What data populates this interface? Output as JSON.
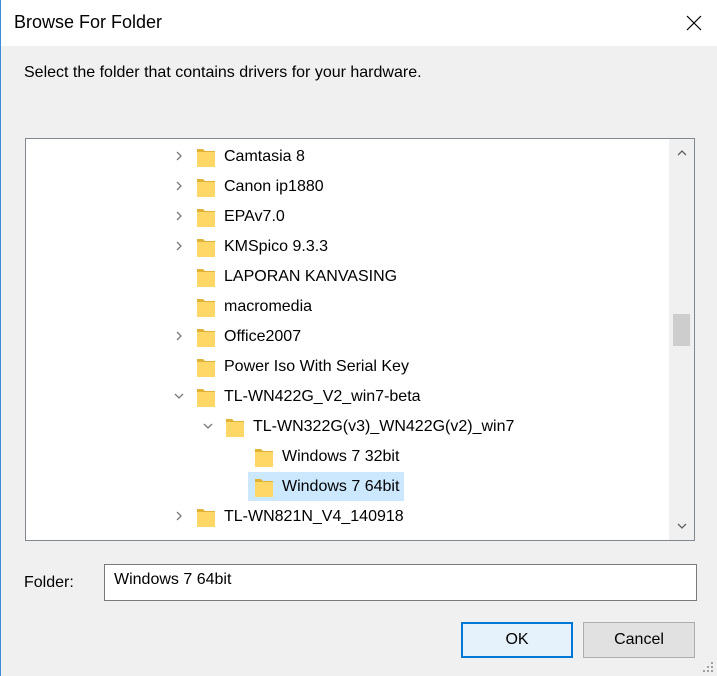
{
  "window": {
    "title": "Browse For Folder"
  },
  "instruction": "Select the folder that contains drivers for your hardware.",
  "tree": {
    "rows": [
      {
        "label": "Camtasia 8",
        "level": 1,
        "expander": "collapsed"
      },
      {
        "label": "Canon ip1880",
        "level": 1,
        "expander": "collapsed"
      },
      {
        "label": "EPAv7.0",
        "level": 1,
        "expander": "collapsed"
      },
      {
        "label": "KMSpico 9.3.3",
        "level": 1,
        "expander": "collapsed"
      },
      {
        "label": "LAPORAN KANVASING",
        "level": 1,
        "expander": "none"
      },
      {
        "label": "macromedia",
        "level": 1,
        "expander": "none"
      },
      {
        "label": "Office2007",
        "level": 1,
        "expander": "collapsed"
      },
      {
        "label": "Power Iso With Serial Key",
        "level": 1,
        "expander": "none"
      },
      {
        "label": "TL-WN422G_V2_win7-beta",
        "level": 1,
        "expander": "expanded"
      },
      {
        "label": "TL-WN322G(v3)_WN422G(v2)_win7",
        "level": 2,
        "expander": "expanded"
      },
      {
        "label": "Windows 7 32bit",
        "level": 3,
        "expander": "none"
      },
      {
        "label": "Windows 7 64bit",
        "level": 3,
        "expander": "none",
        "selected": true
      },
      {
        "label": "TL-WN821N_V4_140918",
        "level": 1,
        "expander": "collapsed"
      }
    ],
    "scroll_position": 0.47
  },
  "folder_field": {
    "label": "Folder:",
    "value": "Windows 7 64bit"
  },
  "buttons": {
    "ok": "OK",
    "cancel": "Cancel"
  },
  "colors": {
    "selection": "#cce8ff",
    "folder_fill": "#ffd766",
    "folder_edge": "#e0b236",
    "default_button_border": "#0078d7"
  },
  "icons": {
    "close": "close-icon",
    "folder": "folder-icon",
    "expand": "chevron-right-icon",
    "collapse": "chevron-down-icon",
    "scroll_up": "chevron-up-icon",
    "scroll_down": "chevron-down-icon"
  }
}
